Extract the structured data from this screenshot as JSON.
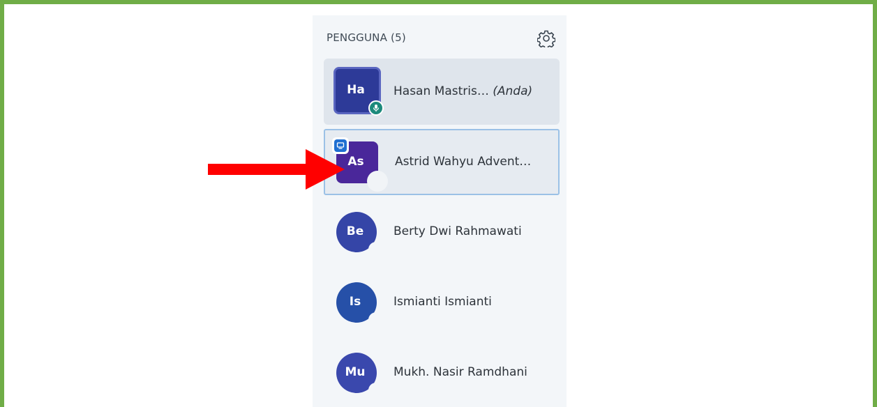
{
  "panel": {
    "title": "PENGGUNA (5)",
    "settings_icon": "gear-icon"
  },
  "users": [
    {
      "initials": "Ha",
      "name": "Hasan Mastris…",
      "you_label": "(Anda)",
      "status_icon": "microphone-icon",
      "avatar_color": "#2d3a98"
    },
    {
      "initials": "As",
      "name": "Astrid Wahyu Advent…",
      "badge_icon": "presenter-icon",
      "avatar_color": "#4a279a"
    },
    {
      "initials": "Be",
      "name": "Berty Dwi Rahmawati",
      "avatar_color": "#3545a7"
    },
    {
      "initials": "Is",
      "name": "Ismianti Ismianti",
      "avatar_color": "#2650a8"
    },
    {
      "initials": "Mu",
      "name": "Mukh. Nasir Ramdhani",
      "avatar_color": "#3a48ad"
    }
  ],
  "annotation": {
    "arrow_color": "#ff0000",
    "frame_color": "#70ad47"
  }
}
